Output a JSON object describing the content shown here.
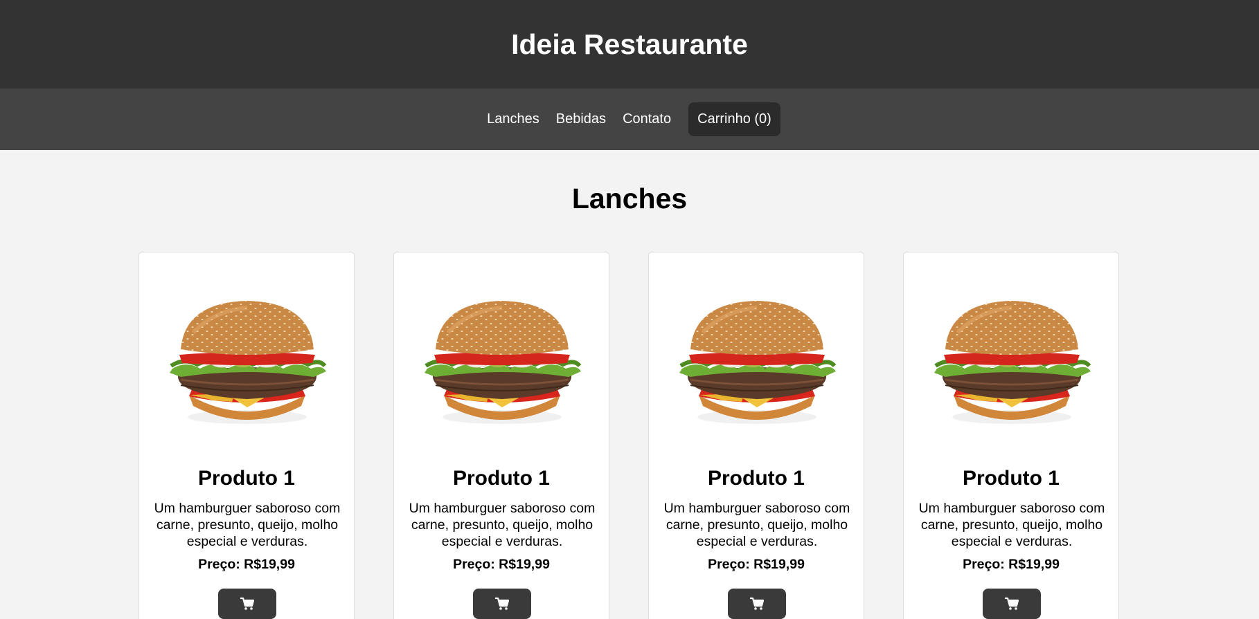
{
  "header": {
    "title": "Ideia Restaurante"
  },
  "nav": {
    "items": [
      {
        "label": "Lanches"
      },
      {
        "label": "Bebidas"
      },
      {
        "label": "Contato"
      }
    ],
    "cart_label": "Carrinho (0)"
  },
  "section": {
    "title": "Lanches"
  },
  "products": [
    {
      "name": "Produto 1",
      "description": "Um hamburguer saboroso com carne, presunto, queijo, molho especial e verduras.",
      "price": "Preço: R$19,99",
      "image_icon": "hamburger-image",
      "button_icon": "cart-icon"
    },
    {
      "name": "Produto 1",
      "description": "Um hamburguer saboroso com carne, presunto, queijo, molho especial e verduras.",
      "price": "Preço: R$19,99",
      "image_icon": "hamburger-image",
      "button_icon": "cart-icon"
    },
    {
      "name": "Produto 1",
      "description": "Um hamburguer saboroso com carne, presunto, queijo, molho especial e verduras.",
      "price": "Preço: R$19,99",
      "image_icon": "hamburger-image",
      "button_icon": "cart-icon"
    },
    {
      "name": "Produto 1",
      "description": "Um hamburguer saboroso com carne, presunto, queijo, molho especial e verduras.",
      "price": "Preço: R$19,99",
      "image_icon": "hamburger-image",
      "button_icon": "cart-icon"
    }
  ],
  "colors": {
    "header_bg": "#333333",
    "nav_bg": "#444444",
    "page_bg": "#f3f3f3",
    "button_bg": "#3a3a3a"
  }
}
